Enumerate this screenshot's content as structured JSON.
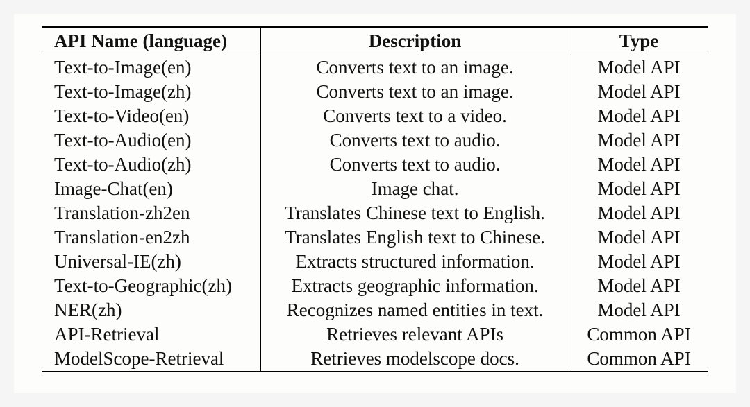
{
  "table": {
    "headers": [
      "API Name (language)",
      "Description",
      "Type"
    ],
    "rows": [
      {
        "name": "Text-to-Image(en)",
        "desc": "Converts text to an image.",
        "type": "Model API"
      },
      {
        "name": "Text-to-Image(zh)",
        "desc": "Converts text to an image.",
        "type": "Model API"
      },
      {
        "name": "Text-to-Video(en)",
        "desc": "Converts text to a video.",
        "type": "Model API"
      },
      {
        "name": "Text-to-Audio(en)",
        "desc": "Converts text to audio.",
        "type": "Model API"
      },
      {
        "name": "Text-to-Audio(zh)",
        "desc": "Converts text to audio.",
        "type": "Model API"
      },
      {
        "name": "Image-Chat(en)",
        "desc": "Image chat.",
        "type": "Model API"
      },
      {
        "name": "Translation-zh2en",
        "desc": "Translates Chinese text to English.",
        "type": "Model API"
      },
      {
        "name": "Translation-en2zh",
        "desc": "Translates English text to Chinese.",
        "type": "Model API"
      },
      {
        "name": "Universal-IE(zh)",
        "desc": "Extracts structured information.",
        "type": "Model API"
      },
      {
        "name": "Text-to-Geographic(zh)",
        "desc": "Extracts geographic information.",
        "type": "Model API"
      },
      {
        "name": "NER(zh)",
        "desc": "Recognizes named entities in text.",
        "type": "Model API"
      },
      {
        "name": "API-Retrieval",
        "desc": "Retrieves relevant APIs",
        "type": "Common API"
      },
      {
        "name": "ModelScope-Retrieval",
        "desc": "Retrieves modelscope docs.",
        "type": "Common API"
      }
    ]
  }
}
